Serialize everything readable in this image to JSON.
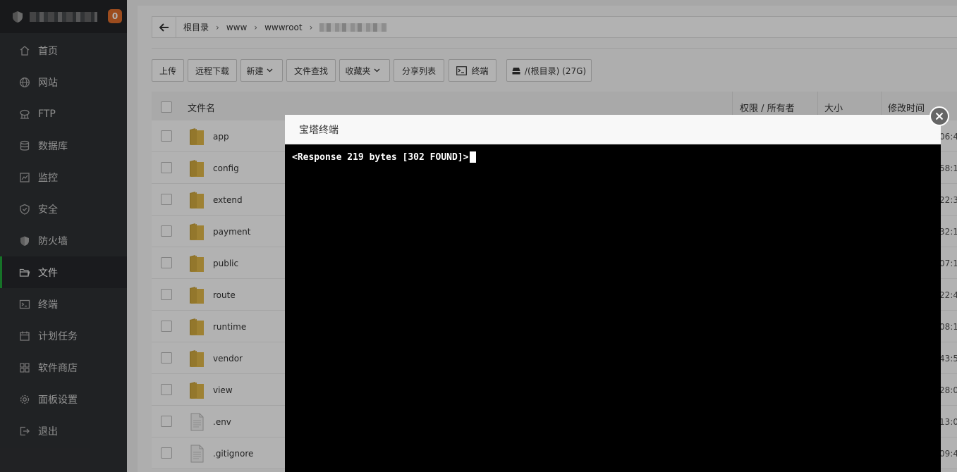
{
  "sidebar": {
    "badge": "0",
    "items": [
      {
        "label": "首页",
        "icon": "home-icon",
        "active": false
      },
      {
        "label": "网站",
        "icon": "globe-icon",
        "active": false
      },
      {
        "label": "FTP",
        "icon": "ftp-icon",
        "active": false
      },
      {
        "label": "数据库",
        "icon": "database-icon",
        "active": false
      },
      {
        "label": "监控",
        "icon": "monitor-icon",
        "active": false
      },
      {
        "label": "安全",
        "icon": "shield-icon",
        "active": false
      },
      {
        "label": "防火墙",
        "icon": "firewall-icon",
        "active": false
      },
      {
        "label": "文件",
        "icon": "folder-icon",
        "active": true
      },
      {
        "label": "终端",
        "icon": "terminal-icon",
        "active": false
      },
      {
        "label": "计划任务",
        "icon": "calendar-icon",
        "active": false
      },
      {
        "label": "软件商店",
        "icon": "grid-icon",
        "active": false
      },
      {
        "label": "面板设置",
        "icon": "gear-icon",
        "active": false
      },
      {
        "label": "退出",
        "icon": "logout-icon",
        "active": false
      }
    ]
  },
  "breadcrumb": {
    "items": [
      "根目录",
      "www",
      "wwwroot"
    ]
  },
  "toolbar": {
    "upload": "上传",
    "remote_download": "远程下载",
    "new": "新建",
    "file_search": "文件查找",
    "favorites": "收藏夹",
    "share_list": "分享列表",
    "terminal": "终端",
    "disk": "/(根目录) (27G)"
  },
  "table": {
    "headers": {
      "name": "文件名",
      "permission": "权限 / 所有者",
      "size": "大小",
      "modified": "修改时间"
    },
    "rows": [
      {
        "name": "app",
        "type": "folder",
        "time": ":06:4"
      },
      {
        "name": "config",
        "type": "folder",
        "time": ":58:1"
      },
      {
        "name": "extend",
        "type": "folder",
        "time": ":22:3"
      },
      {
        "name": "payment",
        "type": "folder",
        "time": ":32:1"
      },
      {
        "name": "public",
        "type": "folder",
        "time": ":07:1"
      },
      {
        "name": "route",
        "type": "folder",
        "time": ":22:4"
      },
      {
        "name": "runtime",
        "type": "folder",
        "time": ":08:1"
      },
      {
        "name": "vendor",
        "type": "folder",
        "time": ":43:5"
      },
      {
        "name": "view",
        "type": "folder",
        "time": ":28:0"
      },
      {
        "name": ".env",
        "type": "file",
        "time": ":13:0"
      },
      {
        "name": ".gitignore",
        "type": "file",
        "time": ":09:4"
      }
    ]
  },
  "dialog": {
    "title": "宝塔终端",
    "terminal_output": "<Response 219 bytes [302 FOUND]>"
  },
  "colors": {
    "sidebar_bg": "#2f3134",
    "active_accent": "#20a53a",
    "badge": "#e06d2b",
    "folder": "#e2b94a"
  }
}
